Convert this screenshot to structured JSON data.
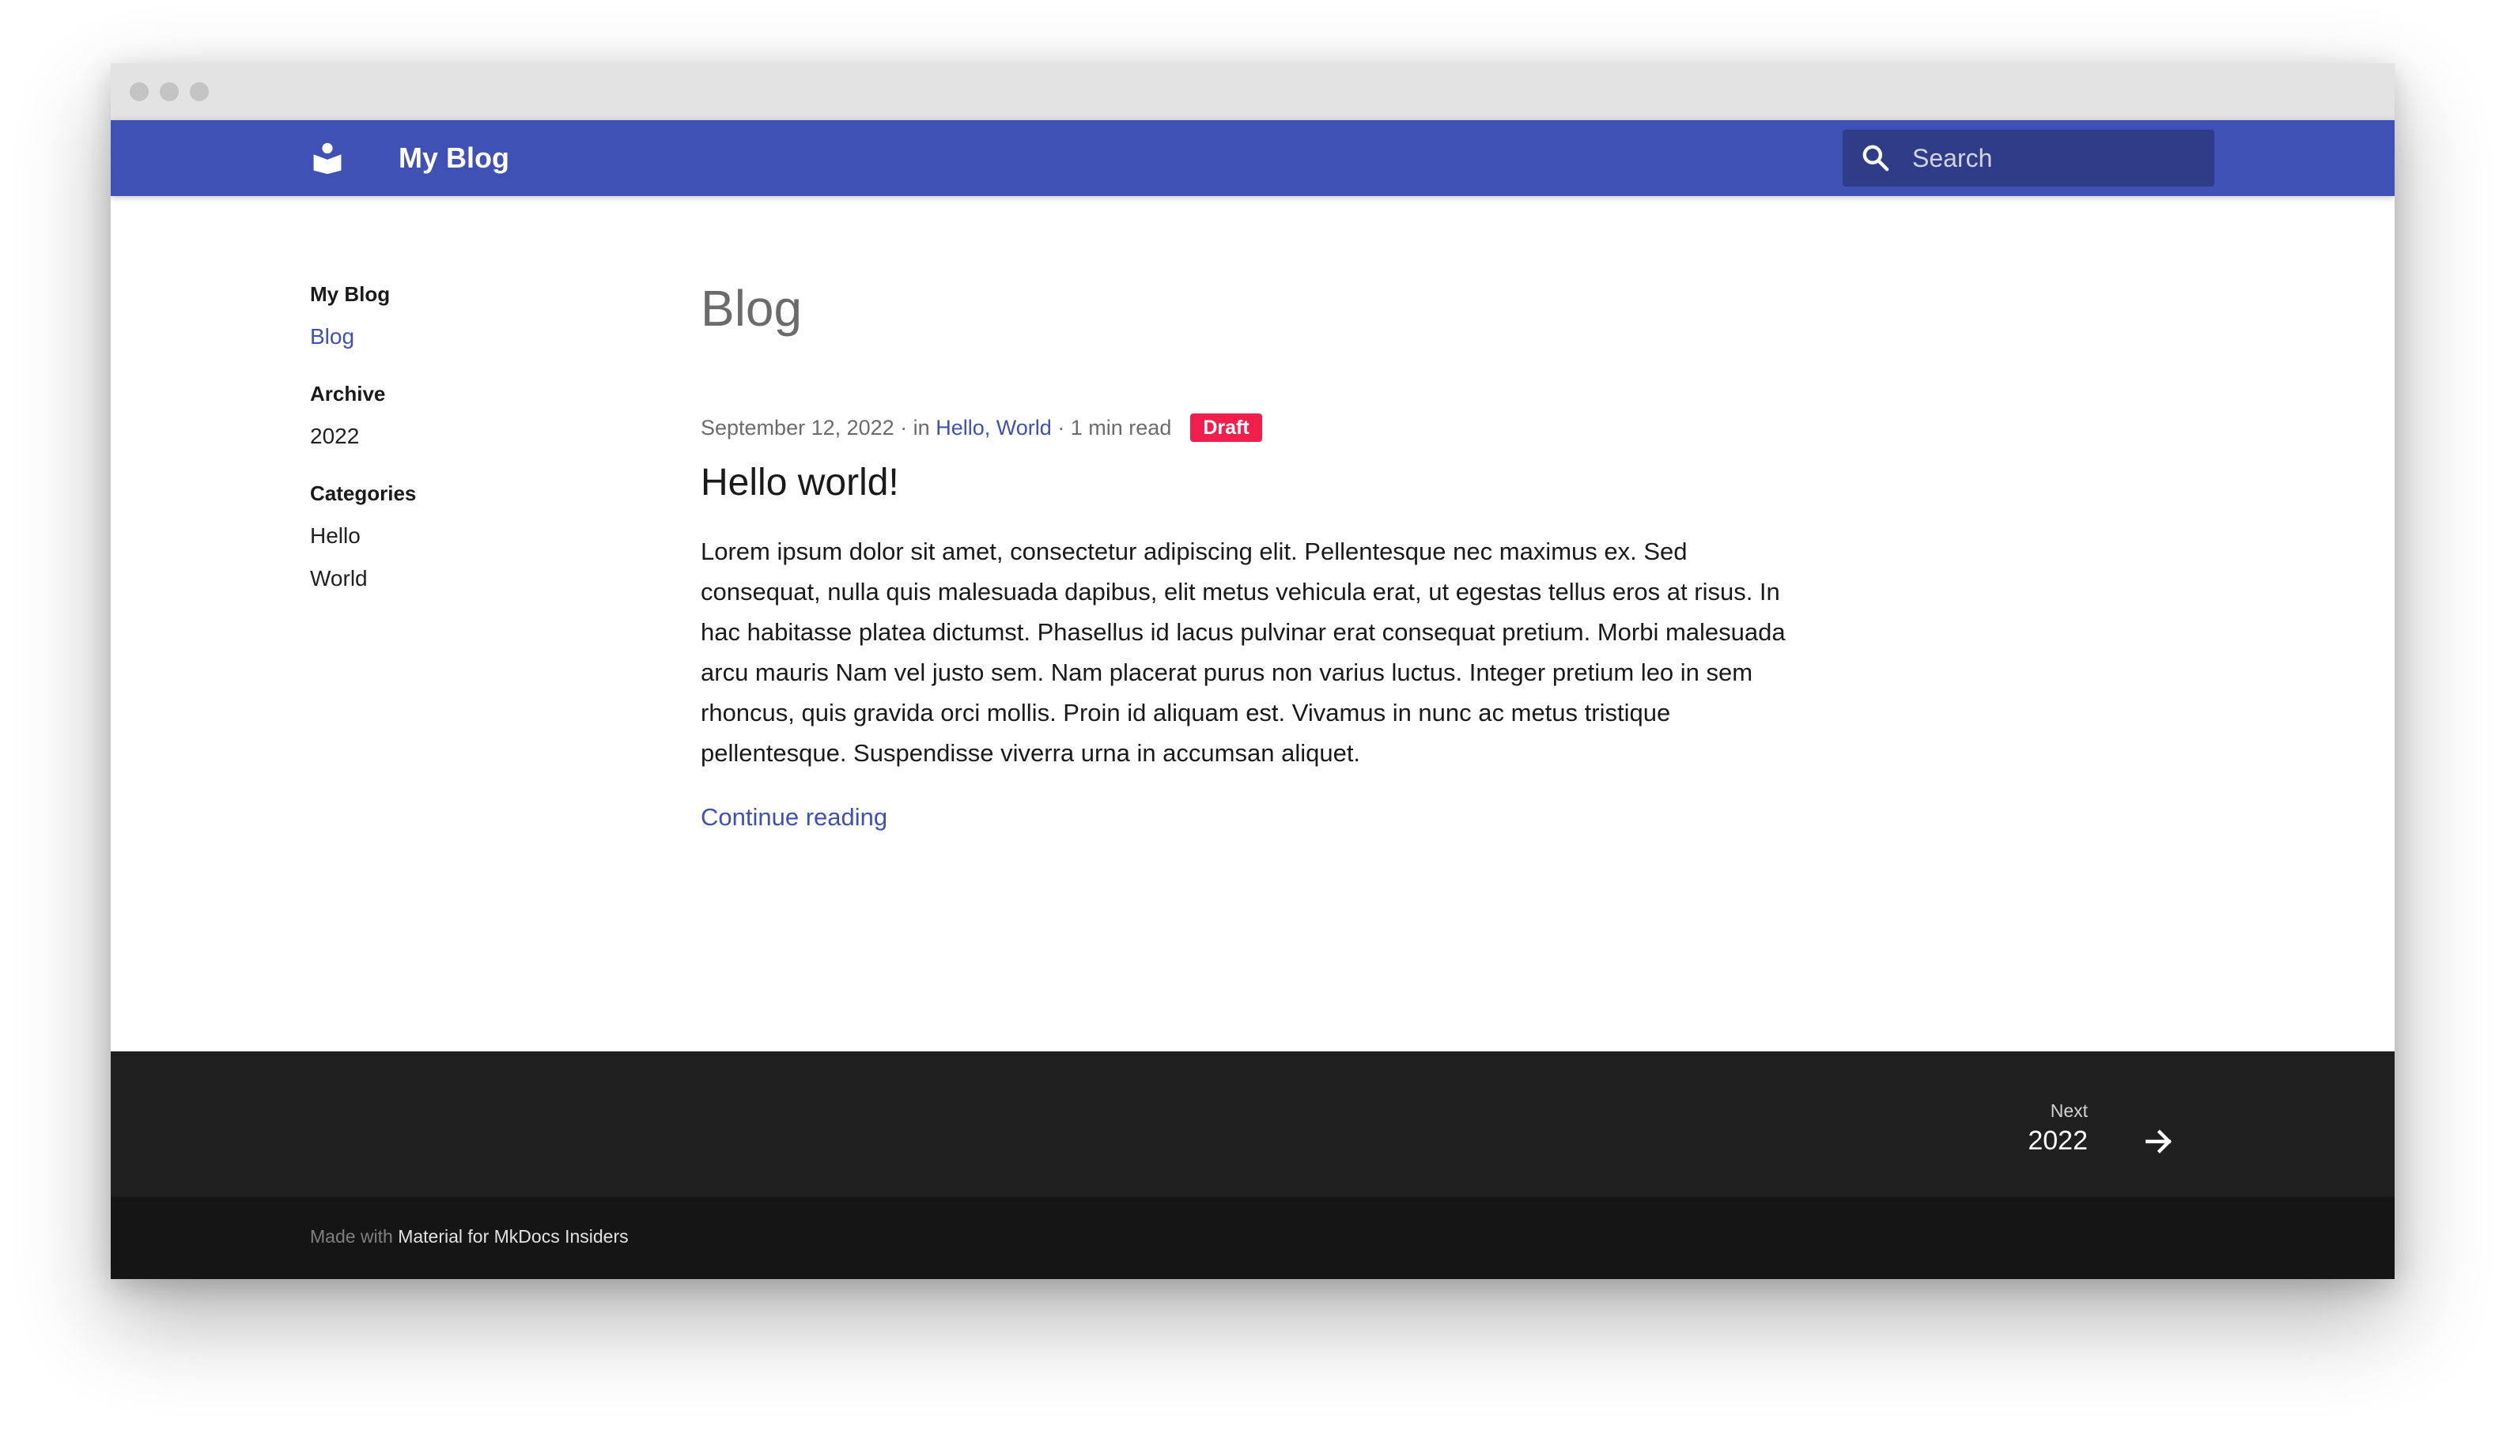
{
  "header": {
    "site_name": "My Blog",
    "search_placeholder": "Search"
  },
  "sidebar": {
    "sections": [
      {
        "title": "My Blog",
        "items": [
          {
            "label": "Blog",
            "active": true
          }
        ]
      },
      {
        "title": "Archive",
        "items": [
          {
            "label": "2022"
          }
        ]
      },
      {
        "title": "Categories",
        "items": [
          {
            "label": "Hello"
          },
          {
            "label": "World"
          }
        ]
      }
    ]
  },
  "main": {
    "page_title": "Blog",
    "post": {
      "date": "September 12, 2022",
      "in_label": " · in ",
      "categories": [
        "Hello",
        "World"
      ],
      "category_separator": ", ",
      "read_time": " · 1 min read",
      "badge": "Draft",
      "title": "Hello world!",
      "body": "Lorem ipsum dolor sit amet, consectetur adipiscing elit. Pellentesque nec maximus ex. Sed consequat, nulla quis malesuada dapibus, elit metus vehicula erat, ut egestas tellus eros at risus. In hac habitasse platea dictumst. Phasellus id lacus pulvinar erat consequat pretium. Morbi malesuada arcu mauris Nam vel justo sem. Nam placerat purus non varius luctus. Integer pretium leo in sem rhoncus, quis gravida orci mollis. Proin id aliquam est. Vivamus in nunc ac metus tristique pellentesque. Suspendisse viverra urna in accumsan aliquet.",
      "continue_label": "Continue reading"
    }
  },
  "footer": {
    "next_label": "Next",
    "next_title": "2022",
    "made_with_prefix": "Made with ",
    "made_with_link": "Material for MkDocs Insiders"
  },
  "icons": {
    "logo": "book-reader-icon",
    "search": "search-icon",
    "next": "arrow-right-icon"
  },
  "colors": {
    "primary": "#4051b5",
    "search_bg": "#2f3c88",
    "badge": "#f01f4c",
    "footer": "#202020",
    "footer_meta": "#151515"
  }
}
